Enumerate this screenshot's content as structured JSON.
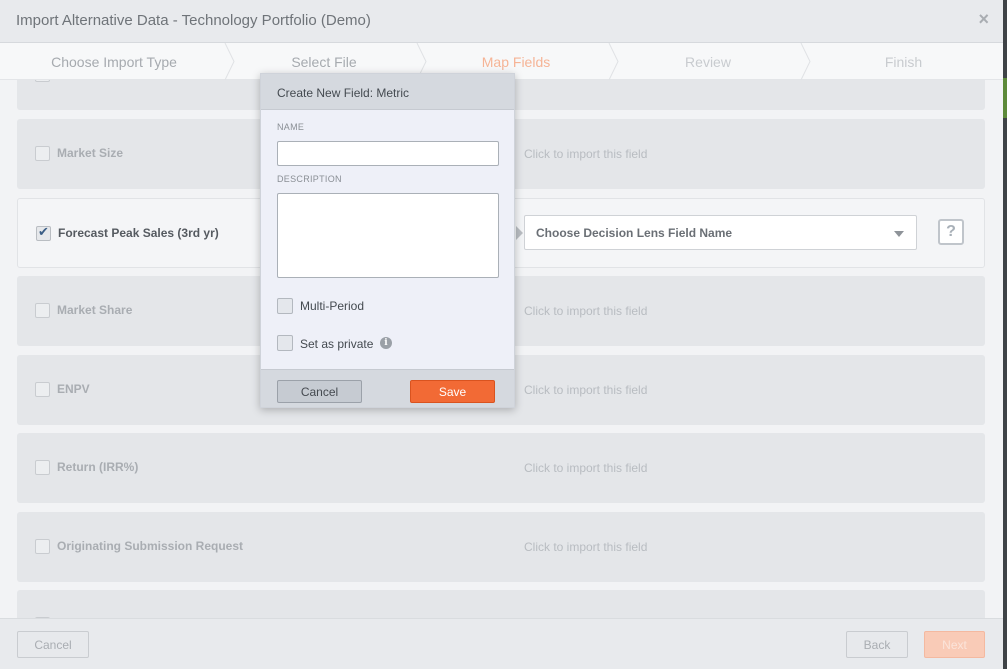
{
  "window": {
    "title": "Import Alternative Data - Technology Portfolio (Demo)",
    "close_symbol": "×"
  },
  "steps": [
    {
      "label": "Choose Import Type",
      "state": "done"
    },
    {
      "label": "Select File",
      "state": "done"
    },
    {
      "label": "Map Fields",
      "state": "current"
    },
    {
      "label": "Review",
      "state": "pending"
    },
    {
      "label": "Finish",
      "state": "pending"
    }
  ],
  "fields": [
    {
      "label": "",
      "checked": false,
      "hint": ""
    },
    {
      "label": "Market Size",
      "checked": false,
      "hint": "Click to import this field"
    },
    {
      "label": "Forecast Peak Sales (3rd yr)",
      "checked": true,
      "select_value": "Choose Decision Lens Field Name",
      "help": "?"
    },
    {
      "label": "Market Share",
      "checked": false,
      "hint": "Click to import this field"
    },
    {
      "label": "ENPV",
      "checked": false,
      "hint": "Click to import this field"
    },
    {
      "label": "Return (IRR%)",
      "checked": false,
      "hint": "Click to import this field"
    },
    {
      "label": "Originating Submission Request",
      "checked": false,
      "hint": "Click to import this field"
    },
    {
      "label": "",
      "checked": false,
      "hint": ""
    }
  ],
  "footer": {
    "cancel": "Cancel",
    "back": "Back",
    "next": "Next"
  },
  "popup": {
    "title": "Create New Field: Metric",
    "name_label": "NAME",
    "name_value": "",
    "description_label": "DESCRIPTION",
    "description_value": "",
    "multi_period_label": "Multi-Period",
    "private_label": "Set as private",
    "info_symbol": "i",
    "cancel": "Cancel",
    "save": "Save"
  },
  "colors": {
    "accent": "#f26a35",
    "current_step": "#f6b496",
    "check": "#3b5e86"
  },
  "icons": {
    "close": "close-icon",
    "checkbox_checked": "checkmark-icon",
    "select_caret": "chevron-down-icon",
    "help": "question-icon",
    "info": "info-icon",
    "row_arrow": "arrow-right-icon"
  }
}
